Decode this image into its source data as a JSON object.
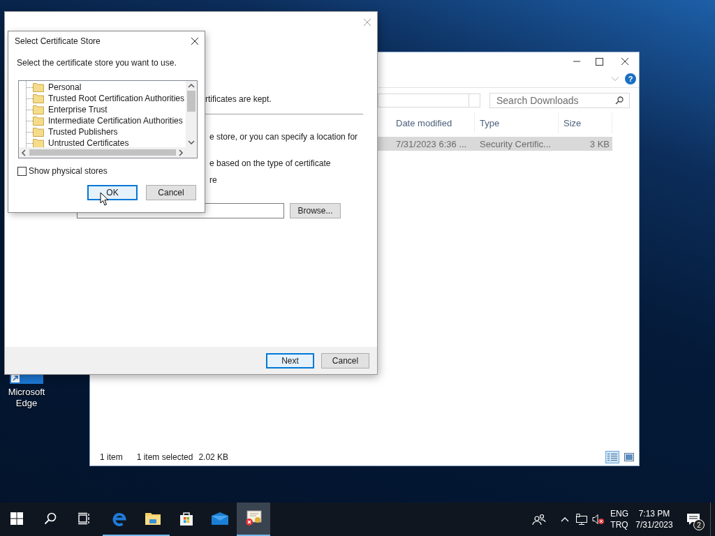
{
  "desktop": {
    "icons": [
      {
        "label": "Microsoft Edge"
      }
    ]
  },
  "explorer": {
    "help": "?",
    "search": {
      "placeholder": "Search Downloads"
    },
    "columns": [
      "Date modified",
      "Type",
      "Size"
    ],
    "rows": [
      {
        "cells": [
          "7/31/2023 6:36 ...",
          "Security Certific...",
          "3 KB"
        ],
        "selected": true
      }
    ],
    "status_bar": {
      "count": "1 item",
      "selection": "1 item selected",
      "size": "2.02 KB"
    },
    "view_buttons": [
      {
        "kind": "details",
        "selected": true
      },
      {
        "kind": "large-icons",
        "selected": false
      }
    ]
  },
  "wizard": {
    "texts": [
      "rtificates are kept.",
      "e store, or you can specify a location for",
      "e based on the type of certificate",
      "re"
    ],
    "browse_button": "Browse...",
    "footer_buttons": [
      {
        "label": "Next",
        "default": true
      },
      {
        "label": "Cancel",
        "default": false
      }
    ]
  },
  "dialog": {
    "title": "Select Certificate Store",
    "prompt": "Select the certificate store you want to use.",
    "stores": [
      "Personal",
      "Trusted Root Certification Authorities",
      "Enterprise Trust",
      "Intermediate Certification Authorities",
      "Trusted Publishers",
      "Untrusted Certificates"
    ],
    "checkbox": {
      "label": "Show physical stores",
      "checked": false
    },
    "buttons": [
      {
        "label": "OK",
        "default": true
      },
      {
        "label": "Cancel",
        "default": false
      }
    ]
  },
  "taskbar": {
    "buttons": [
      {
        "kind": "start",
        "running": false,
        "active": false
      },
      {
        "kind": "search",
        "running": false,
        "active": false
      },
      {
        "kind": "task-view",
        "running": false,
        "active": false
      },
      {
        "kind": "edge",
        "running": true,
        "active": false
      },
      {
        "kind": "explorer",
        "running": true,
        "active": false
      },
      {
        "kind": "store",
        "running": false,
        "active": false
      },
      {
        "kind": "mail",
        "running": false,
        "active": false
      },
      {
        "kind": "certificate",
        "running": true,
        "active": true
      }
    ],
    "volume": {
      "muted": true
    },
    "language": [
      "ENG",
      "TRQ"
    ],
    "time": "7:13 PM",
    "date": "7/31/2023",
    "notifications": "2"
  }
}
